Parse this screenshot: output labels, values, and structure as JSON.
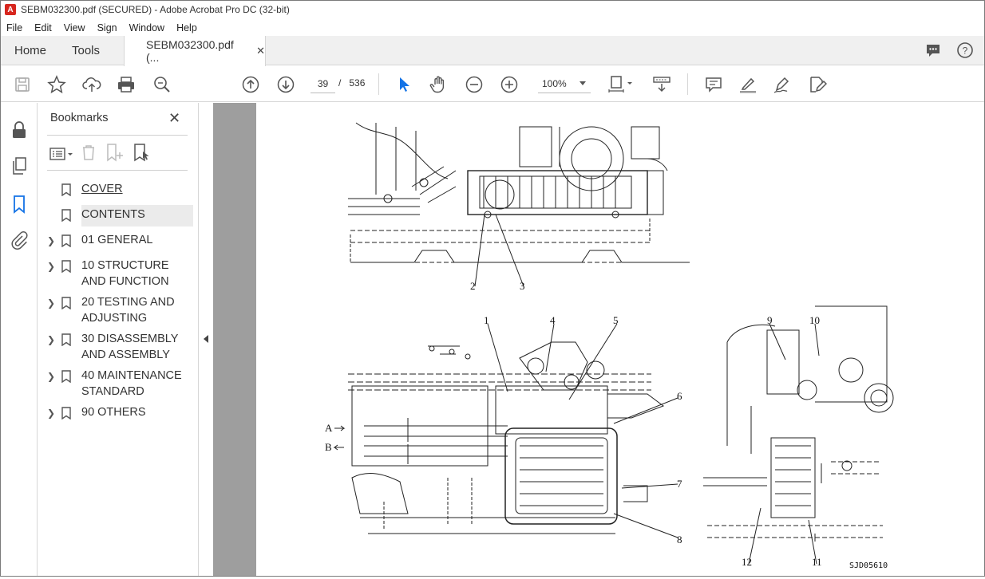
{
  "window": {
    "title": "SEBM032300.pdf (SECURED) - Adobe Acrobat Pro DC (32-bit)"
  },
  "menu": [
    "File",
    "Edit",
    "View",
    "Sign",
    "Window",
    "Help"
  ],
  "tabs": {
    "home": "Home",
    "tools": "Tools",
    "document": "SEBM032300.pdf (..."
  },
  "toolbar": {
    "current_page": "39",
    "page_separator": "/",
    "total_pages": "536",
    "zoom": "100%"
  },
  "bookmarks": {
    "title": "Bookmarks",
    "items": [
      {
        "label": "COVER",
        "expandable": false,
        "selected": false
      },
      {
        "label": "CONTENTS",
        "expandable": false,
        "selected": true
      },
      {
        "label": "01 GENERAL",
        "expandable": true,
        "selected": false
      },
      {
        "label": "10 STRUCTURE AND FUNCTION",
        "expandable": true,
        "selected": false
      },
      {
        "label": "20 TESTING AND ADJUSTING",
        "expandable": true,
        "selected": false
      },
      {
        "label": "30 DISASSEMBLY AND ASSEMBLY",
        "expandable": true,
        "selected": false
      },
      {
        "label": "40 MAINTENANCE STANDARD",
        "expandable": true,
        "selected": false
      },
      {
        "label": "90 OTHERS",
        "expandable": true,
        "selected": false
      }
    ]
  },
  "drawing": {
    "callouts": [
      "2",
      "3",
      "1",
      "4",
      "5",
      "6",
      "7",
      "8",
      "9",
      "10",
      "11",
      "12"
    ],
    "flow_a": "A",
    "flow_b": "B",
    "figure_id": "SJD05610"
  },
  "colors": {
    "viewer_bg": "#9e9e9e",
    "select_blue": "#1473e6",
    "app_red": "#d7261e"
  }
}
